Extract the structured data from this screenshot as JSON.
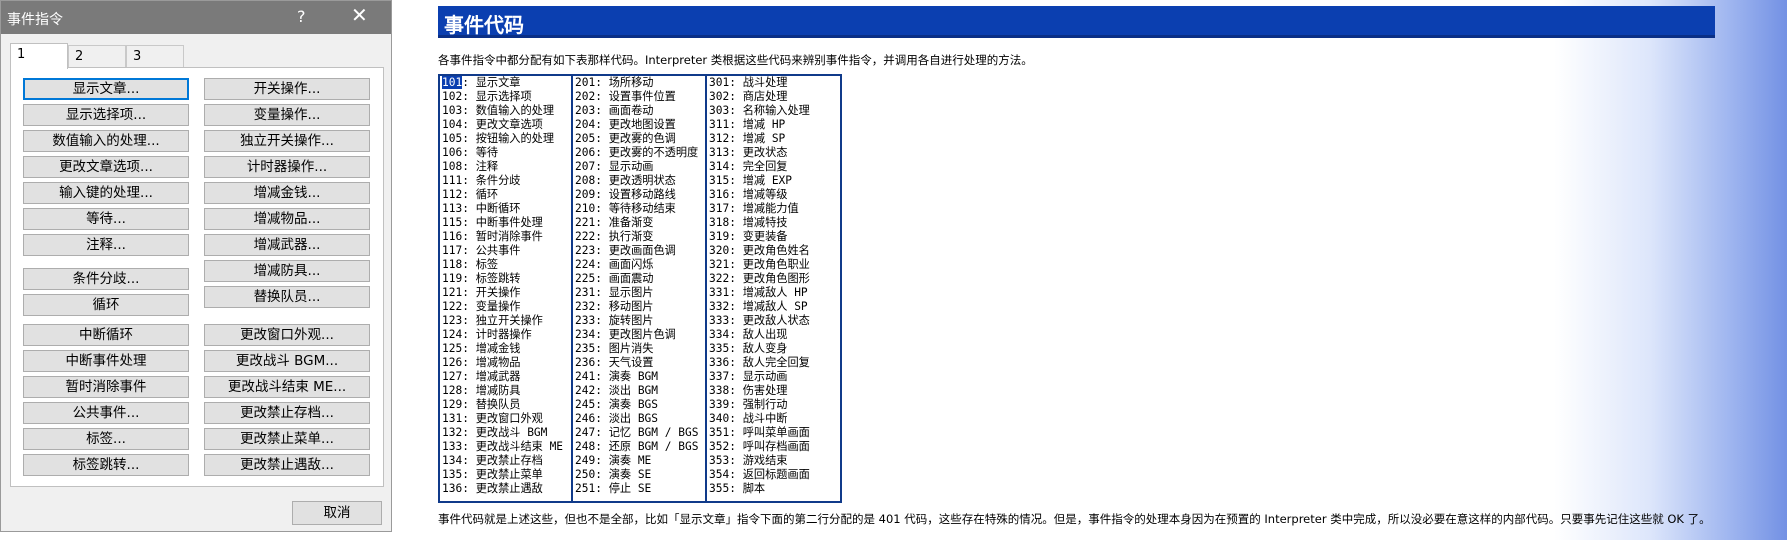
{
  "dialog": {
    "title": "事件指令",
    "help_glyph": "?",
    "close_glyph": "✕",
    "tabs": [
      "1",
      "2",
      "3"
    ],
    "active_tab": 0,
    "buttons_left": [
      "显示文章...",
      "显示选择项...",
      "数值输入的处理...",
      "更改文章选项...",
      "输入键的处理...",
      "等待...",
      "注释...",
      "条件分歧...",
      "循环",
      "中断循环",
      "中断事件处理",
      "暂时消除事件",
      "公共事件...",
      "标签...",
      "标签跳转..."
    ],
    "buttons_right": [
      "开关操作...",
      "变量操作...",
      "独立开关操作...",
      "计时器操作...",
      "增减金钱...",
      "增减物品...",
      "增减武器...",
      "增减防具...",
      "替换队员...",
      "更改窗口外观...",
      "更改战斗 BGM...",
      "更改战斗结束 ME...",
      "更改禁止存档...",
      "更改禁止菜单...",
      "更改禁止遇敌..."
    ],
    "cancel_label": "取消"
  },
  "doc": {
    "title": "事件代码",
    "intro": "各事件指令中都分配有如下表那样代码。Interpreter 类根据这些代码来辨别事件指令，并调用各自进行处理的方法。",
    "outro": "事件代码就是上述这些，但也不是全部，比如「显示文章」指令下面的第二行分配的是 401 代码，这些存在特殊的情况。但是，事件指令的处理本身因为在预置的 Interpreter 类中完成，所以没必要在意这样的内部代码。只要事先记住这些就 OK 了。",
    "selected_code": "101",
    "col1": [
      [
        "101",
        "显示文章"
      ],
      [
        "102",
        "显示选择项"
      ],
      [
        "103",
        "数值输入的处理"
      ],
      [
        "104",
        "更改文章选项"
      ],
      [
        "105",
        "按钮输入的处理"
      ],
      [
        "106",
        "等待"
      ],
      [
        "108",
        "注释"
      ],
      [
        "111",
        "条件分歧"
      ],
      [
        "112",
        "循环"
      ],
      [
        "113",
        "中断循环"
      ],
      [
        "115",
        "中断事件处理"
      ],
      [
        "116",
        "暂时消除事件"
      ],
      [
        "117",
        "公共事件"
      ],
      [
        "118",
        "标签"
      ],
      [
        "119",
        "标签跳转"
      ],
      [
        "121",
        "开关操作"
      ],
      [
        "122",
        "变量操作"
      ],
      [
        "123",
        "独立开关操作"
      ],
      [
        "124",
        "计时器操作"
      ],
      [
        "125",
        "增减金钱"
      ],
      [
        "126",
        "增减物品"
      ],
      [
        "127",
        "增减武器"
      ],
      [
        "128",
        "增减防具"
      ],
      [
        "129",
        "替换队员"
      ],
      [
        "131",
        "更改窗口外观"
      ],
      [
        "132",
        "更改战斗 BGM"
      ],
      [
        "133",
        "更改战斗结束 ME"
      ],
      [
        "134",
        "更改禁止存档"
      ],
      [
        "135",
        "更改禁止菜单"
      ],
      [
        "136",
        "更改禁止遇敌"
      ]
    ],
    "col2": [
      [
        "201",
        "场所移动"
      ],
      [
        "202",
        "设置事件位置"
      ],
      [
        "203",
        "画面卷动"
      ],
      [
        "204",
        "更改地图设置"
      ],
      [
        "205",
        "更改雾的色调"
      ],
      [
        "206",
        "更改雾的不透明度"
      ],
      [
        "207",
        "显示动画"
      ],
      [
        "208",
        "更改透明状态"
      ],
      [
        "209",
        "设置移动路线"
      ],
      [
        "210",
        "等待移动结束"
      ],
      [
        "221",
        "准备渐变"
      ],
      [
        "222",
        "执行渐变"
      ],
      [
        "223",
        "更改画面色调"
      ],
      [
        "224",
        "画面闪烁"
      ],
      [
        "225",
        "画面震动"
      ],
      [
        "231",
        "显示图片"
      ],
      [
        "232",
        "移动图片"
      ],
      [
        "233",
        "旋转图片"
      ],
      [
        "234",
        "更改图片色调"
      ],
      [
        "235",
        "图片消失"
      ],
      [
        "236",
        "天气设置"
      ],
      [
        "241",
        "演奏 BGM"
      ],
      [
        "242",
        "淡出 BGM"
      ],
      [
        "245",
        "演奏 BGS"
      ],
      [
        "246",
        "淡出 BGS"
      ],
      [
        "247",
        "记忆 BGM / BGS"
      ],
      [
        "248",
        "还原 BGM / BGS"
      ],
      [
        "249",
        "演奏 ME"
      ],
      [
        "250",
        "演奏 SE"
      ],
      [
        "251",
        "停止 SE"
      ]
    ],
    "col3": [
      [
        "301",
        "战斗处理"
      ],
      [
        "302",
        "商店处理"
      ],
      [
        "303",
        "名称输入处理"
      ],
      [
        "311",
        "增减 HP"
      ],
      [
        "312",
        "增减 SP"
      ],
      [
        "313",
        "更改状态"
      ],
      [
        "314",
        "完全回复"
      ],
      [
        "315",
        "增减 EXP"
      ],
      [
        "316",
        "增减等级"
      ],
      [
        "317",
        "增减能力值"
      ],
      [
        "318",
        "增减特技"
      ],
      [
        "319",
        "变更装备"
      ],
      [
        "320",
        "更改角色姓名"
      ],
      [
        "321",
        "更改角色职业"
      ],
      [
        "322",
        "更改角色图形"
      ],
      [
        "331",
        "增减敌人 HP"
      ],
      [
        "332",
        "增减敌人 SP"
      ],
      [
        "333",
        "更改敌人状态"
      ],
      [
        "334",
        "敌人出现"
      ],
      [
        "335",
        "敌人变身"
      ],
      [
        "336",
        "敌人完全回复"
      ],
      [
        "337",
        "显示动画"
      ],
      [
        "338",
        "伤害处理"
      ],
      [
        "339",
        "强制行动"
      ],
      [
        "340",
        "战斗中断"
      ],
      [
        "351",
        "呼叫菜单画面"
      ],
      [
        "352",
        "呼叫存档画面"
      ],
      [
        "353",
        "游戏结束"
      ],
      [
        "354",
        "返回标题画面"
      ],
      [
        "355",
        "脚本"
      ]
    ]
  }
}
